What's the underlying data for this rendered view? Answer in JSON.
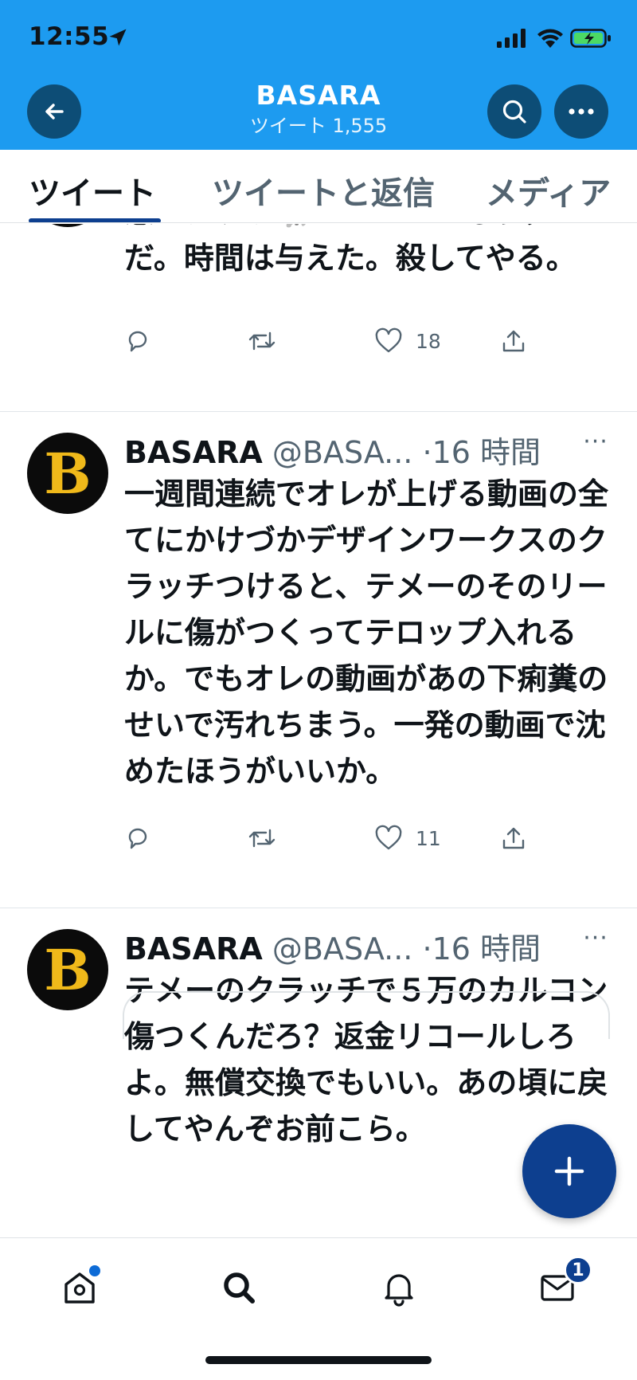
{
  "status_bar": {
    "time": "12:55"
  },
  "header": {
    "title": "BASARA",
    "subtitle": "ツイート 1,555"
  },
  "tabs": [
    {
      "label": "ツイート"
    },
    {
      "label": "ツイートと返信"
    },
    {
      "label": "メディア"
    }
  ],
  "tweets": [
    {
      "avatar_letter": "B",
      "text": "怒ったゾウ🐘パオーン！もうダメだ。時間は与えた。殺してやる。",
      "replies": "",
      "retweets": "",
      "likes": "18"
    },
    {
      "avatar_letter": "B",
      "name": "BASARA",
      "handle": "@BASA...",
      "time": "·16 時間",
      "more": "···",
      "text": "一週間連続でオレが上げる動画の全てにかけづかデザインワークスのクラッチつけると、テメーのそのリールに傷がつくってテロップ入れるか。でもオレの動画があの下痢糞のせいで汚れちまう。一発の動画で沈めたほうがいいか。",
      "replies": "",
      "retweets": "",
      "likes": "11"
    },
    {
      "avatar_letter": "B",
      "name": "BASARA",
      "handle": "@BASA...",
      "time": "·16 時間",
      "more": "···",
      "text": "テメーのクラッチで５万のカルコン傷つくんだろ？返金リコールしろよ。無償交換でもいい。あの頃に戻してやんぞお前こら。"
    }
  ],
  "bottom_nav": {
    "dm_badge": "1"
  },
  "colors": {
    "header_bg": "#1d9bf0",
    "accent": "#0d3f8f",
    "text": "#0f1419",
    "muted": "#536471"
  },
  "icons": [
    "back-arrow-icon",
    "search-icon",
    "more-icon",
    "reply-icon",
    "retweet-icon",
    "heart-icon",
    "share-icon",
    "plus-icon",
    "home-icon",
    "notification-bell-icon",
    "mail-icon"
  ]
}
